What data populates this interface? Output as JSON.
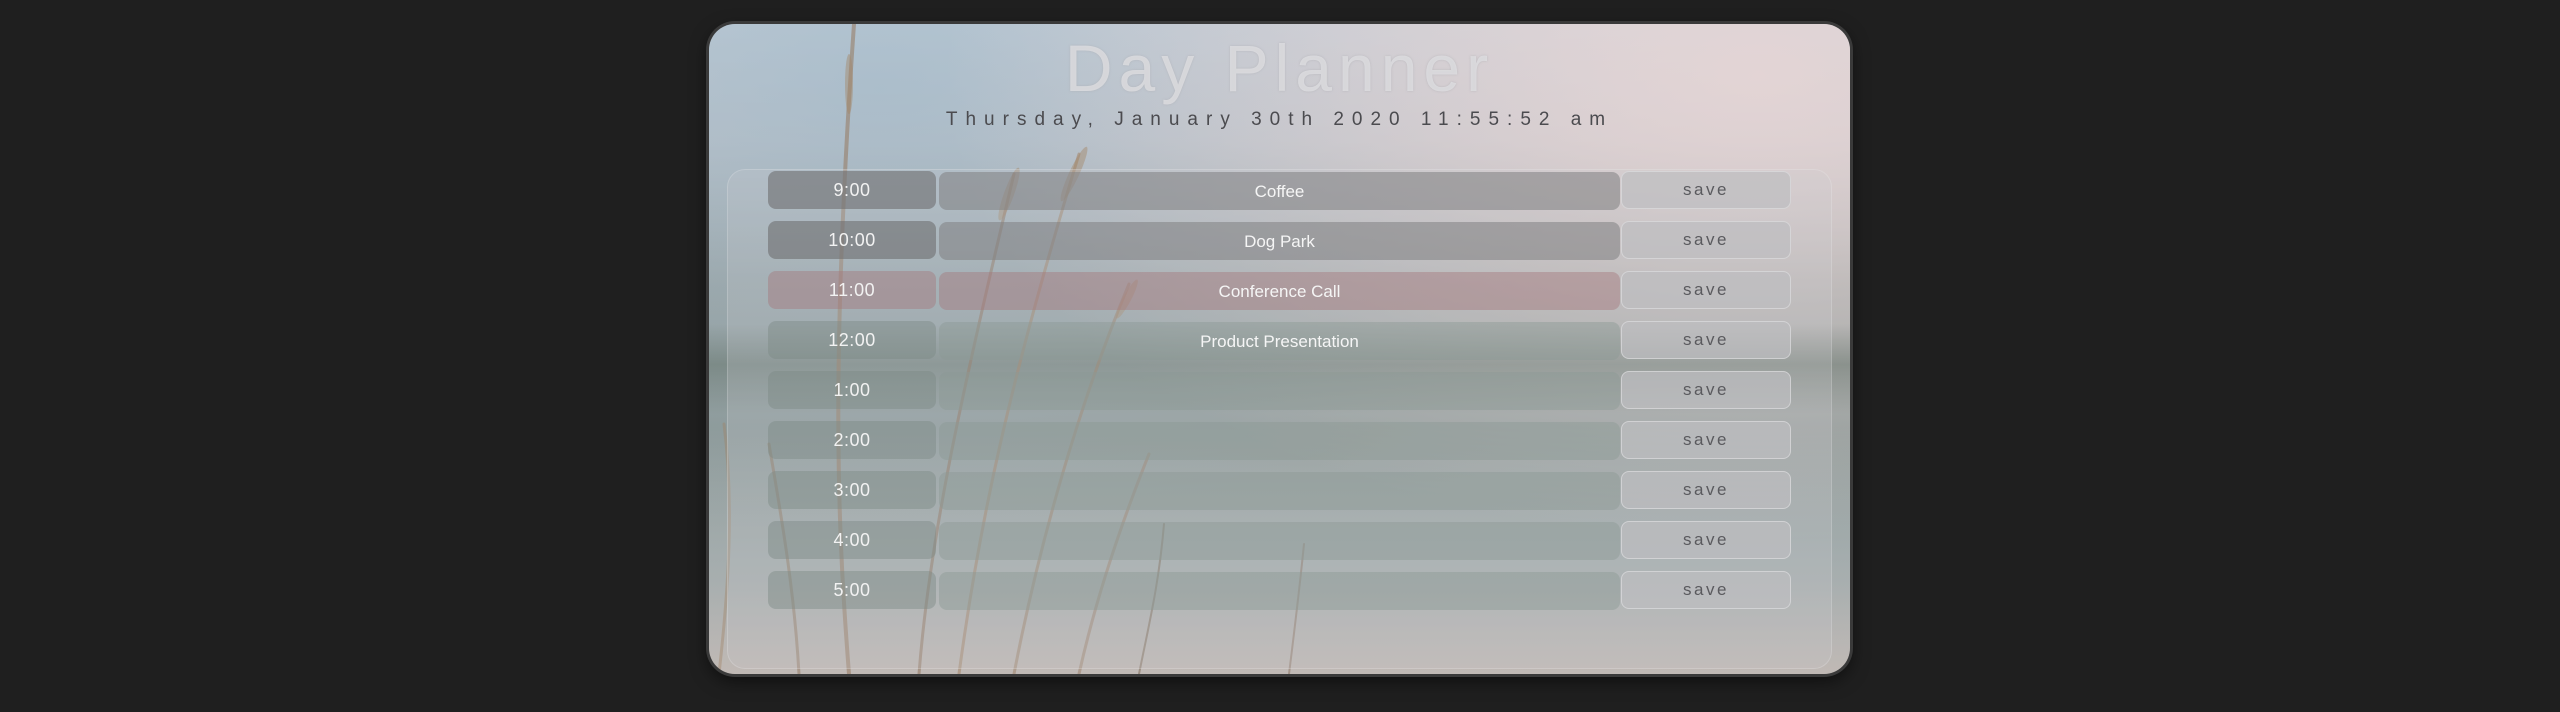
{
  "header": {
    "title": "Day Planner",
    "date": "Thursday, January 30th 2020 11:55:52 am"
  },
  "colors": {
    "page_background": "#1f1f1f",
    "past": "#6e6e70",
    "present": "#a5787d",
    "future": "#7d8a84",
    "save_text": "#5a5a5e"
  },
  "rows": [
    {
      "hour": "9:00",
      "event": "Coffee",
      "save_label": "save",
      "state": "past"
    },
    {
      "hour": "10:00",
      "event": "Dog Park",
      "save_label": "save",
      "state": "past"
    },
    {
      "hour": "11:00",
      "event": "Conference Call",
      "save_label": "save",
      "state": "present"
    },
    {
      "hour": "12:00",
      "event": "Product Presentation",
      "save_label": "save",
      "state": "future"
    },
    {
      "hour": "1:00",
      "event": "",
      "save_label": "save",
      "state": "future"
    },
    {
      "hour": "2:00",
      "event": "",
      "save_label": "save",
      "state": "future"
    },
    {
      "hour": "3:00",
      "event": "",
      "save_label": "save",
      "state": "future"
    },
    {
      "hour": "4:00",
      "event": "",
      "save_label": "save",
      "state": "future"
    },
    {
      "hour": "5:00",
      "event": "",
      "save_label": "save",
      "state": "future"
    }
  ]
}
